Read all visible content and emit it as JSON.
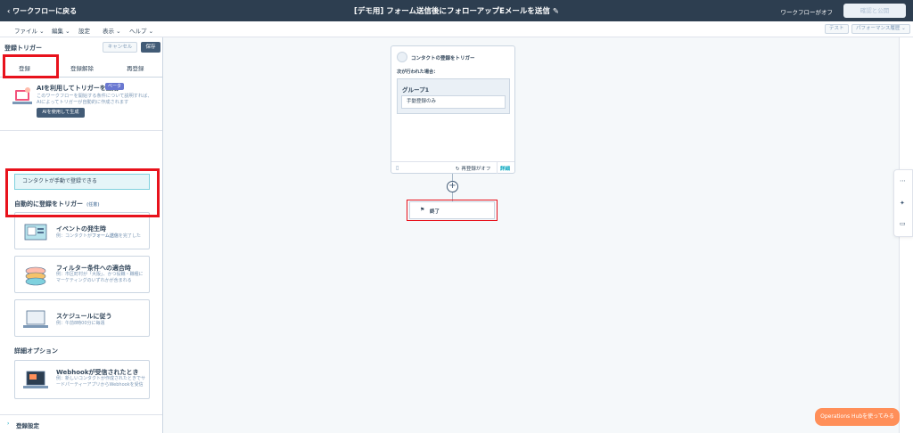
{
  "topbar": {
    "back_label": "ワークフローに戻る",
    "title": "[デモ用] フォーム送信後にフォローアップEメールを送信",
    "status": "ワークフローがオフ",
    "review_label": "確認と公開"
  },
  "menubar": {
    "items": [
      "ファイル",
      "編集",
      "設定",
      "表示",
      "ヘルプ"
    ],
    "test_label": "テスト",
    "performance_label": "パフォーマンス履歴"
  },
  "panel": {
    "title": "登録トリガー",
    "cancel_label": "キャンセル",
    "save_label": "保存",
    "tabs": [
      "登録",
      "登録解除",
      "再登録"
    ],
    "ai": {
      "title": "AIを利用してトリガーを生成",
      "badge": "ベータ",
      "description": "このワークフローを開始する条件について説明すれば、AIによってトリガーが自動的に作成されます",
      "button": "AIを使用して生成"
    },
    "info": "コンタクトが手動で登録できる",
    "auto_title": "自動的に登録をトリガー",
    "auto_sub": "(任意)",
    "cards": [
      {
        "title": "イベントの発生時",
        "desc_prefix": "例：コンタクトが",
        "desc_bold": "フォーム送信",
        "desc_suffix": "を完了した"
      },
      {
        "title": "フィルター条件への適合時",
        "desc": "例：市区町村が「大阪」、かつ役職・職種にマーケティングのいずれかが含まれる"
      },
      {
        "title": "スケジュールに従う",
        "desc": "例：午前8時00分に毎週"
      }
    ],
    "advanced_title": "詳細オプション",
    "webhook": {
      "title": "Webhookが受信されたとき",
      "desc": "例：新しいコンタクトが作成されたときでサードパーティーアプリからWebhookを受信"
    },
    "settings_label": "登録設定"
  },
  "canvas": {
    "trigger_title": "コンタクトの登録をトリガー",
    "trigger_sub": "次が行われた場合：",
    "group_label": "グループ1",
    "group_value": "手動登録のみ",
    "reenroll_label": "再登録がオフ",
    "detail_label": "詳細",
    "end_label": "終了"
  },
  "ops_button": "Operations Hubを使ってみる",
  "colors": {
    "topbar": "#2d3e50",
    "accent": "#00a4bd",
    "highlight": "#e8121c",
    "cta": "#ff8f59"
  }
}
